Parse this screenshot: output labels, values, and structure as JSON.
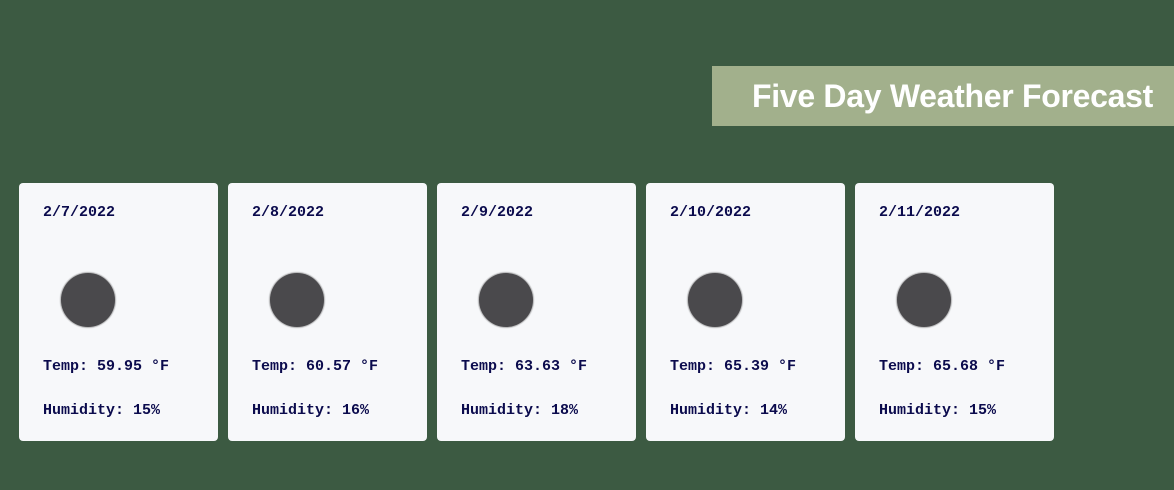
{
  "header": {
    "title": "Five Day Weather Forecast"
  },
  "colors": {
    "background": "#3c5a42",
    "banner": "#a2b08c",
    "card": "#f7f8fa",
    "card_text": "#0b0b4d",
    "icon": "#4a494c"
  },
  "forecast": [
    {
      "date": "2/7/2022",
      "icon": "dark-circle-weather-icon",
      "temp": "Temp: 59.95 °F",
      "humidity": "Humidity: 15%"
    },
    {
      "date": "2/8/2022",
      "icon": "dark-circle-weather-icon",
      "temp": "Temp: 60.57 °F",
      "humidity": "Humidity: 16%"
    },
    {
      "date": "2/9/2022",
      "icon": "dark-circle-weather-icon",
      "temp": "Temp: 63.63 °F",
      "humidity": "Humidity: 18%"
    },
    {
      "date": "2/10/2022",
      "icon": "dark-circle-weather-icon",
      "temp": "Temp: 65.39 °F",
      "humidity": "Humidity: 14%"
    },
    {
      "date": "2/11/2022",
      "icon": "dark-circle-weather-icon",
      "temp": "Temp: 65.68 °F",
      "humidity": "Humidity: 15%"
    }
  ]
}
